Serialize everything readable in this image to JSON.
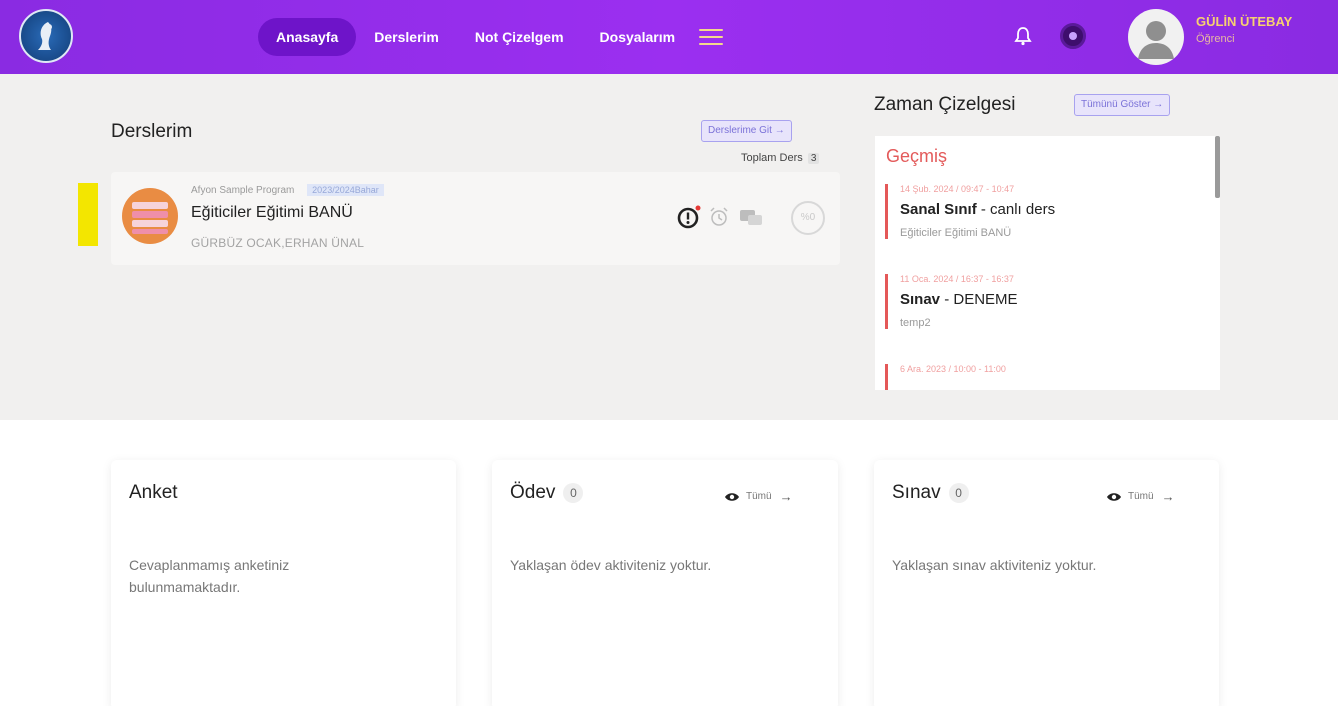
{
  "header": {
    "nav": [
      "Anasayfa",
      "Derslerim",
      "Not Çizelgem",
      "Dosyalarım"
    ],
    "user_name": "GÜLİN ÜTEBAY",
    "user_role": "Öğrenci"
  },
  "courses": {
    "title": "Derslerim",
    "go_button": "Derslerime Git",
    "total_label": "Toplam Ders",
    "total_count": "3",
    "items": [
      {
        "program": "Afyon Sample Program",
        "term": "2023/2024Bahar",
        "name": "Eğiticiler Eğitimi BANÜ",
        "teachers": "GÜRBÜZ OCAK,ERHAN ÜNAL",
        "badge": "%0"
      }
    ]
  },
  "timeline": {
    "title": "Zaman Çizelgesi",
    "show_all": "Tümünü Göster",
    "past_label": "Geçmiş",
    "items": [
      {
        "date": "14 Şub. 2024 / 09:47 - 10:47",
        "type": "Sanal Sınıf",
        "name": "canlı ders",
        "course": "Eğiticiler Eğitimi BANÜ"
      },
      {
        "date": "11 Oca. 2024 / 16:37 - 16:37",
        "type": "Sınav",
        "name": "DENEME",
        "course": "temp2"
      },
      {
        "date": "6 Ara. 2023 / 10:00 - 11:00",
        "type": "",
        "name": "",
        "course": ""
      }
    ]
  },
  "cards": {
    "anket": {
      "title": "Anket",
      "text": "Cevaplanmamış anketiniz bulunmamaktadır."
    },
    "odev": {
      "title": "Ödev",
      "count": "0",
      "all": "Tümü",
      "text": "Yaklaşan ödev aktiviteniz yoktur."
    },
    "sinav": {
      "title": "Sınav",
      "count": "0",
      "all": "Tümü",
      "text": "Yaklaşan sınav aktiviteniz yoktur."
    }
  },
  "colors": {
    "header": "#8a2be2",
    "active_nav": "#6e14c9",
    "accent_red": "#e45858",
    "highlight": "#f3e600"
  },
  "icons": [
    "logo",
    "menu-icon",
    "bell-icon",
    "notification-ring-icon",
    "avatar-icon",
    "warning-icon",
    "alarm-icon",
    "chat-icon",
    "eye-icon",
    "arrow-right-icon"
  ]
}
